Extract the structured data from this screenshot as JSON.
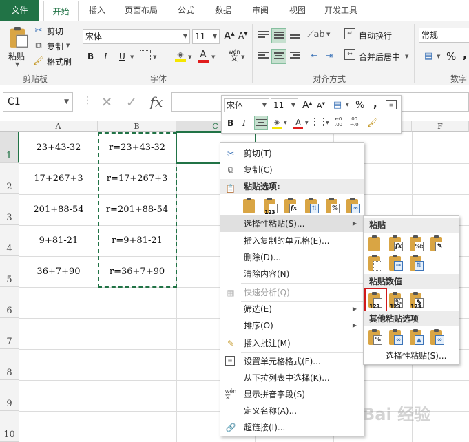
{
  "tabs": [
    "文件",
    "开始",
    "插入",
    "页面布局",
    "公式",
    "数据",
    "审阅",
    "视图",
    "开发工具"
  ],
  "ribbon": {
    "clipboard": {
      "paste": "粘贴",
      "cut": "剪切",
      "copy": "复制",
      "format_painter": "格式刷",
      "label": "剪贴板"
    },
    "font": {
      "name": "宋体",
      "size": "11",
      "grow": "A",
      "shrink": "A",
      "bold": "B",
      "italic": "I",
      "underline": "U",
      "font_color": "A",
      "phonetic": "wén",
      "label": "字体"
    },
    "alignment": {
      "wrap": "自动换行",
      "merge": "合并后居中",
      "label": "对齐方式"
    },
    "number": {
      "format": "常规",
      "percent": "%",
      "label": "数字"
    }
  },
  "formula_bar": {
    "name_box": "C1",
    "cancel": "✕",
    "enter": "✓",
    "fx": "fx",
    "value": ""
  },
  "columns": [
    "A",
    "B",
    "C",
    "D",
    "E",
    "F"
  ],
  "rows": [
    "1",
    "2",
    "3",
    "4",
    "5",
    "6",
    "7",
    "8",
    "9",
    "10"
  ],
  "cells": {
    "A": [
      "23+43-32",
      "17+267+3",
      "201+88-54",
      "9+81-21",
      "36+7+90"
    ],
    "B": [
      "r=23+43-32",
      "r=17+267+3",
      "r=201+88-54",
      "r=9+81-21",
      "r=36+7+90"
    ]
  },
  "mini_toolbar": {
    "font": "宋体",
    "size": "11",
    "bold": "B",
    "italic": "I",
    "percent": "%",
    "comma": ",",
    "dec_more": ".00→.0",
    "dec_less": ".00→.0"
  },
  "context_menu": {
    "cut": "剪切(T)",
    "copy": "复制(C)",
    "paste_options_header": "粘贴选项:",
    "paste_special": "选择性粘贴(S)...",
    "insert_copied": "插入复制的单元格(E)...",
    "delete": "删除(D)...",
    "clear": "清除内容(N)",
    "quick_analysis": "快速分析(Q)",
    "filter": "筛选(E)",
    "sort": "排序(O)",
    "insert_comment": "插入批注(M)",
    "format_cells": "设置单元格格式(F)...",
    "pick_list": "从下拉列表中选择(K)...",
    "phonetic": "显示拼音字段(S)",
    "define_name": "定义名称(A)...",
    "hyperlink": "超链接(I)..."
  },
  "submenu": {
    "paste_header": "粘贴",
    "values_header": "粘贴数值",
    "other_header": "其他粘贴选项",
    "footer": "选择性粘贴(S)..."
  },
  "paste_icon_labels": {
    "values": "123",
    "percent": "%",
    "fx": "fx"
  },
  "watermark": "Bai 经验",
  "colors": {
    "excel_green": "#217346",
    "highlight": "#d0191a"
  }
}
